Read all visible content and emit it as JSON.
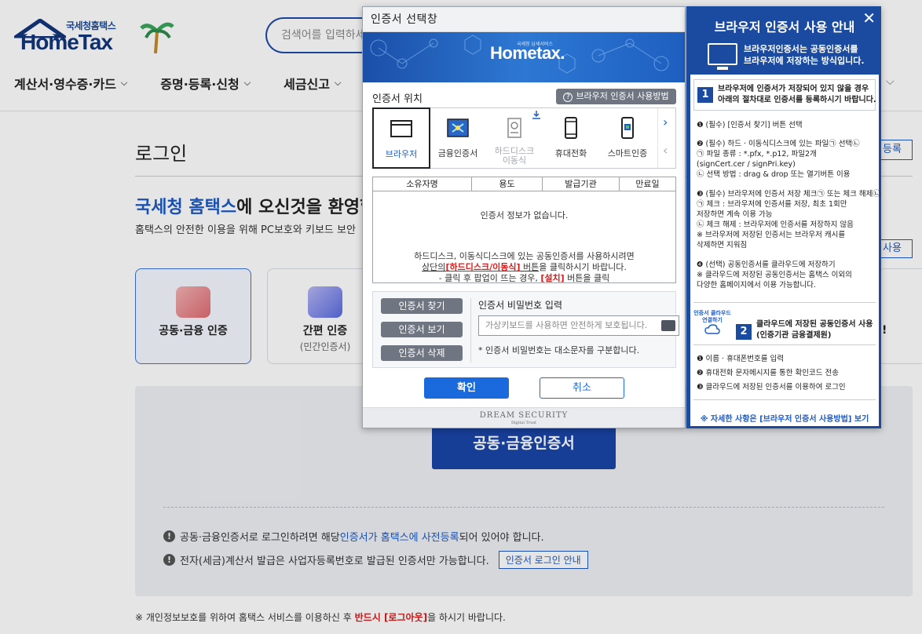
{
  "header": {
    "logo_sub": "국세청홈택스",
    "logo_main": "HomeTax",
    "search_placeholder": "검색어를 입력하세",
    "nav": [
      {
        "label": "계산서·영수증·카드"
      },
      {
        "label": "증명·등록·신청"
      },
      {
        "label": "세금신고"
      }
    ]
  },
  "page": {
    "title": "로그인",
    "welcome_brand": "국세청 홈택스",
    "welcome_rest": "에 오신것을 환영합",
    "welcome_sub": "홈택스의 안전한 이용을 위해 PC보호와 키보드 보안",
    "register_label": "등록",
    "use_label": "사용",
    "cards": [
      {
        "label": "공동·금융 인증",
        "sub": ""
      },
      {
        "label": "간편 인증",
        "sub": "(민간인증서)"
      }
    ],
    "main_button": "공동·금융인증서",
    "notices": [
      {
        "pre": "공동·금융인증서로 로그인하려면 해당 ",
        "link": "인증서가 홈택스에 사전등록",
        "post": "되어 있어야 합니다."
      },
      {
        "pre": "전자(세금)계산서 발급은 사업자등록번호로 발급된 인증서만 가능합니다.",
        "button": "인증서 로그인 안내"
      }
    ],
    "footer_pre": "※ 개인정보보호를 위하여 홈택스 서비스를 이용하신 후 ",
    "footer_red": "반드시 [로그아웃]",
    "footer_post": "을 하시기 바랍니다."
  },
  "modal": {
    "title": "인증서 선택창",
    "banner_logo": "Hometax.",
    "banner_sub": "국세청 납세서비스",
    "location_label": "인증서 위치",
    "how_to_label": "브라우저 인증서 사용방법",
    "locations": [
      {
        "label": "브라우저",
        "state": "selected"
      },
      {
        "label": "금융인증서",
        "state": "normal"
      },
      {
        "label": "하드디스크\n이동식",
        "state": "disabled"
      },
      {
        "label": "휴대전화",
        "state": "normal"
      },
      {
        "label": "스마트인증",
        "state": "normal"
      }
    ],
    "columns": [
      "소유자명",
      "용도",
      "발급기관",
      "만료일"
    ],
    "empty_text": "인증서 정보가 없습니다.",
    "msg_line1": "하드디스크, 이동식디스크에 있는 공동인증서를 사용하시려면",
    "msg_line2_pre": "상단의",
    "msg_line2_red": "[하드디스크/이동식]",
    "msg_line2_mid": " 버튼",
    "msg_line2_post": "을 클릭하시기 바랍니다.",
    "msg_line3_pre": "- 클릭 후 팝업이 뜨는 경우, ",
    "msg_line3_red": "[설치]",
    "msg_line3_post": " 버튼을 클릭",
    "buttons": {
      "find": "인증서 찾기",
      "view": "인증서 보기",
      "delete": "인증서 삭제"
    },
    "pw_label": "인증서 비밀번호 입력",
    "pw_placeholder": "가상키보드를 사용하면 안전하게 보호됩니다.",
    "pw_hint": "* 인증서 비밀번호는 대소문자를 구분합니다.",
    "ok": "확인",
    "cancel": "취소",
    "footer_brand": "DREAM SECURITY",
    "footer_tagline": "Digital Trust"
  },
  "guide": {
    "title": "브라우저 인증서 사용 안내",
    "intro": [
      "브라우저인증서는 공동인증서를",
      "브라우저에 저장하는 방식입니다."
    ],
    "step1": [
      "브라우저에 인증서가 저장되어 있지 않을 경우",
      "아래의 절차대로 인증서를 등록하시기 바랍니다."
    ],
    "step1_lines": [
      "❶ (필수) [인증서 찾기] 버튼 선택",
      "❷ (필수) 하드 · 이동식디스크에 있는 파일㉠ 선택㉡",
      "   ㉠ 파일 종류 : *.pfx,  *.p12, 파일2개",
      "         (signCert.cer / signPri.key)",
      "   ㉡ 선택 방법 : drag & drop 또는 열기버튼 이용",
      "❸ (필수) 브라우저에 인증서 저장 체크㉠ 또는 체크 해제㉡",
      "   ㉠ 체크 : 브라우저에 인증서를 저장, 최초 1회만",
      "         저장하면 계속 이용 가능",
      "   ㉡ 체크 해제 : 브라우저에 인증서를 저장하지 않음",
      "   ※ 브라우저에 저장된 인증서는 브라우저 캐시를",
      "         삭제하면 지워짐",
      "❹ (선택) 공동인증서를 클라우드에 저장하기",
      "   ※ 클라우드에 저장된 공동인증서는 홈택스 이외의",
      "         다양한 홈페이지에서 이용 가능합니다."
    ],
    "cloud_label": "인증서 클라우드\n연결하기",
    "step2": [
      "클라우드에 저장된 공동인증서 사용",
      "(인증기관 금융결제원)"
    ],
    "step2_lines": [
      "❶ 이름 · 휴대폰번호를 입력",
      "❷ 휴대전화 문자메시지를 통한 확인코드 전송",
      "❸ 클라우드에 저장된 인증서를 이용하여 로그인"
    ],
    "link": "※ 자세한 사항은 [브라우저 인증서 사용방법] 보기"
  }
}
